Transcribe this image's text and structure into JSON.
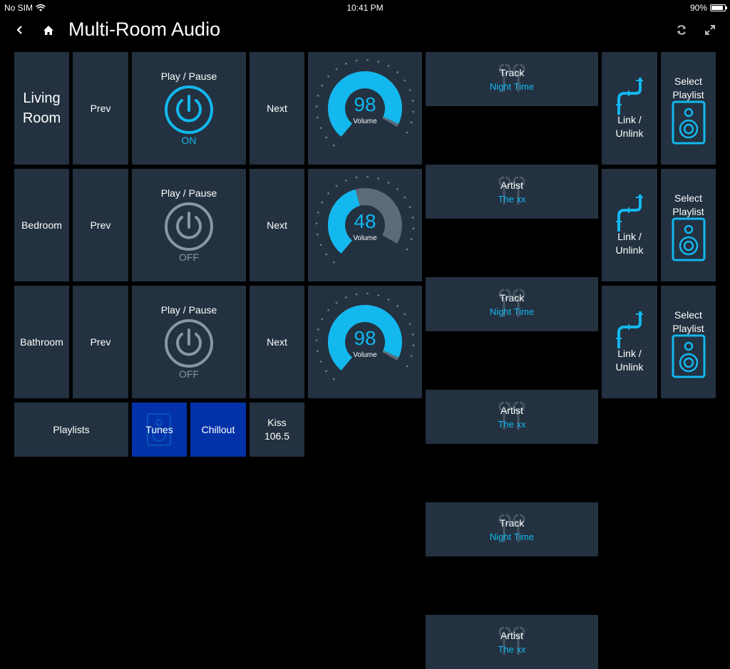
{
  "status": {
    "carrier": "No SIM",
    "time": "10:41 PM",
    "battery": "90%",
    "battery_level": 0.9
  },
  "header": {
    "title": "Multi-Room Audio"
  },
  "labels": {
    "prev": "Prev",
    "next": "Next",
    "play_pause": "Play / Pause",
    "track": "Track",
    "artist": "Artist",
    "volume": "Volume",
    "link_line1": "Link /",
    "link_line2": "Unlink",
    "select_line1": "Select",
    "select_line2": "Playlist"
  },
  "rooms": [
    {
      "name": "Living Room",
      "power": "ON",
      "power_on": true,
      "volume": 98,
      "track": "Night Time",
      "artist": "The xx"
    },
    {
      "name": "Bedroom",
      "power": "OFF",
      "power_on": false,
      "volume": 48,
      "track": "Night Time",
      "artist": "The xx"
    },
    {
      "name": "Bathroom",
      "power": "OFF",
      "power_on": false,
      "volume": 98,
      "track": "Night Time",
      "artist": "The xx"
    }
  ],
  "playlists": {
    "label": "Playlists",
    "items": [
      {
        "label": "Tunes",
        "active": true
      },
      {
        "label": "Chillout",
        "active": true
      },
      {
        "label": "Kiss 106.5",
        "active": false
      }
    ]
  },
  "colors": {
    "tile": "#233140",
    "accent": "#13b8ee",
    "inactive": "#8896a6",
    "active_playlist": "#0332a8",
    "volume_track": "#5c6b7a"
  },
  "icons": [
    "back-icon",
    "home-icon",
    "refresh-icon",
    "fullscreen-icon",
    "power-icon",
    "pipe-link-icon",
    "speaker-icon",
    "earbuds-icon",
    "wifi-icon",
    "battery-icon"
  ]
}
